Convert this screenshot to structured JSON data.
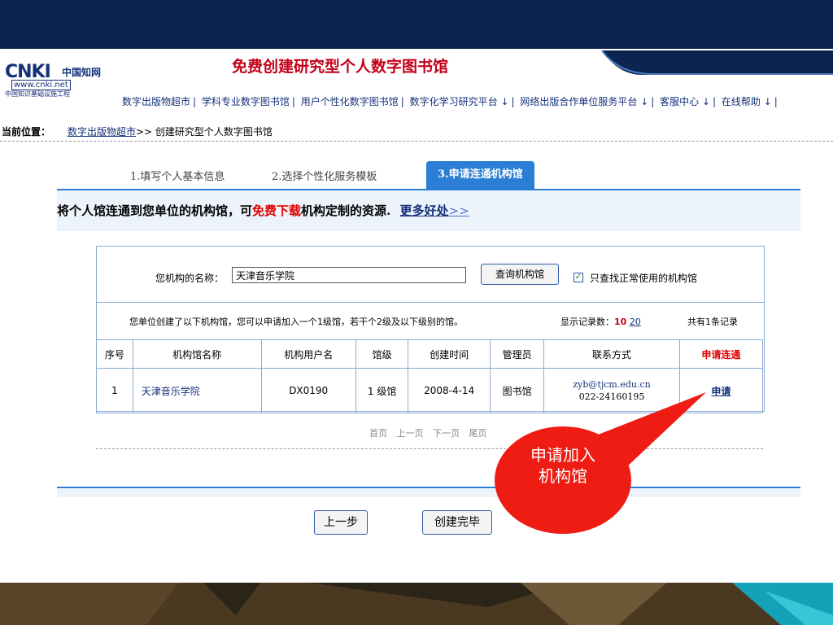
{
  "header": {
    "logo": {
      "main": "CNKI",
      "cn_name": "中国知网",
      "url": "www.cnki.net",
      "subtitle": "中国知识基础设施工程"
    },
    "title": "免费创建研究型个人数字图书馆",
    "nav": [
      "数字出版物超市",
      "学科专业数字图书馆",
      "用户个性化数字图书馆",
      "数字化学习研究平台 ↓",
      "网络出版合作单位服务平台 ↓",
      "客服中心 ↓",
      "在线帮助 ↓"
    ]
  },
  "breadcrumb": {
    "label": "当前位置：",
    "link": "数字出版物超市",
    "rest": ">> 创建研究型个人数字图书馆"
  },
  "steps": [
    {
      "label": "1.填写个人基本信息"
    },
    {
      "label": "2.选择个性化服务模板"
    },
    {
      "label": "3.申请连通机构馆"
    }
  ],
  "promo": {
    "prefix": "将个人馆连通到您单位的机构馆，可",
    "highlight": "免费下载",
    "suffix": "机构定制的资源.",
    "more": "更多好处",
    "more_arrow": ">>"
  },
  "search": {
    "label": "您机构的名称：",
    "value": "天津音乐学院",
    "button": "查询机构馆",
    "checkbox_checked": true,
    "checkbox_label": "只查找正常使用的机构馆"
  },
  "info": {
    "left": "您单位创建了以下机构馆，您可以申请加入一个1级馆，若干个2级及以下级别的馆。",
    "display_label": "显示记录数：",
    "display_current": "10",
    "display_other": "20",
    "total": "共有1条记录"
  },
  "table": {
    "headers": [
      "序号",
      "机构馆名称",
      "机构用户名",
      "馆级",
      "创建时间",
      "管理员",
      "联系方式",
      "申请连通"
    ],
    "rows": [
      {
        "index": "1",
        "name": "天津音乐学院",
        "username": "DX0190",
        "level": "1 级馆",
        "created": "2008-4-14",
        "admin": "图书馆",
        "email": "zyb@tjcm.edu.cn",
        "phone": "022-24160195",
        "action": "申请"
      }
    ]
  },
  "pager": [
    "首页",
    "上一页",
    "下一页",
    "尾页"
  ],
  "buttons": {
    "prev": "上一步",
    "done": "创建完毕"
  },
  "callout": {
    "text": "申请加入机构馆"
  },
  "colors": {
    "accent": "#2a7ed3",
    "title_red": "#c4001a",
    "link": "#14307a",
    "callout": "#ee1c12"
  }
}
